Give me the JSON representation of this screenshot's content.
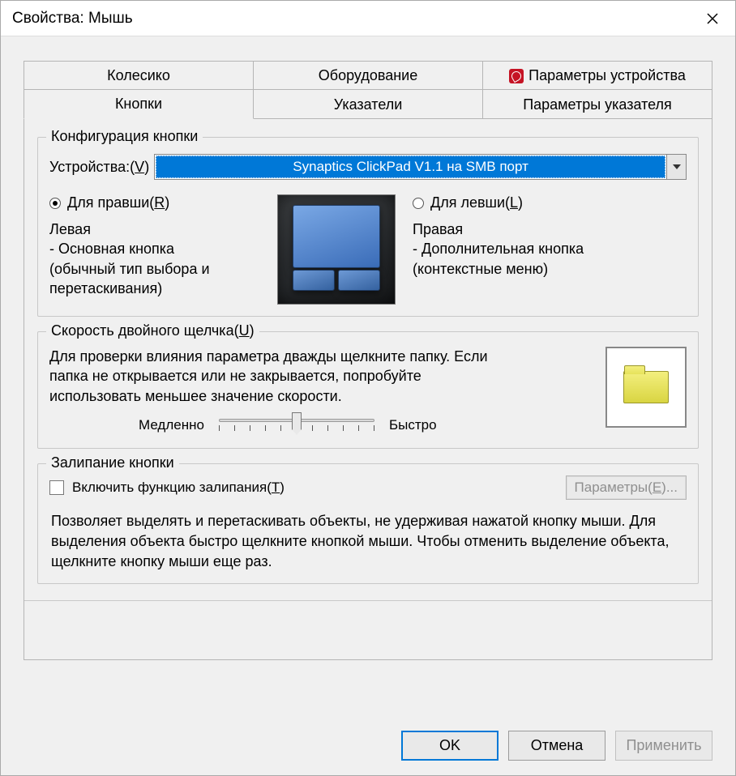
{
  "window": {
    "title": "Свойства: Мышь"
  },
  "tabs": {
    "row1": [
      {
        "label": "Колесико"
      },
      {
        "label": "Оборудование"
      },
      {
        "label": "Параметры устройства"
      }
    ],
    "row2": [
      {
        "label": "Кнопки"
      },
      {
        "label": "Указатели"
      },
      {
        "label": "Параметры указателя"
      }
    ]
  },
  "config": {
    "group_title": "Конфигурация кнопки",
    "device_label_pre": "Устройства:(",
    "device_label_hot": "V",
    "device_label_post": ")",
    "device_selected": "Synaptics ClickPad V1.1 на SMB порт",
    "right_hand_pre": "Для правши(",
    "right_hand_hot": "R",
    "right_hand_post": ")",
    "left_hand_pre": "Для левши(",
    "left_hand_hot": "L",
    "left_hand_post": ")",
    "left_title": "Левая",
    "left_line1": " - Основная кнопка",
    "left_line2": "(обычный тип выбора и перетаскивания)",
    "right_title": "Правая",
    "right_line1": " - Дополнительная кнопка",
    "right_line2": "(контекстные меню)"
  },
  "double_click": {
    "group_pre": "Скорость двойного щелчка(",
    "group_hot": "U",
    "group_post": ")",
    "text": "Для проверки влияния параметра дважды щелкните папку. Если папка не открывается или не закрывается, попробуйте использовать меньшее значение скорости.",
    "slow": "Медленно",
    "fast": "Быстро"
  },
  "sticky": {
    "group_title": "Залипание кнопки",
    "checkbox_pre": "Включить функцию залипания(",
    "checkbox_hot": "Т",
    "checkbox_post": ")",
    "params_pre": "Параметры(",
    "params_hot": "Е",
    "params_post": ")...",
    "desc": "Позволяет выделять и перетаскивать объекты, не удерживая нажатой кнопку мыши. Для выделения объекта быстро щелкните кнопкой мыши. Чтобы отменить выделение объекта, щелкните кнопку мыши еще раз."
  },
  "buttons": {
    "ok": "OK",
    "cancel": "Отмена",
    "apply": "Применить"
  }
}
